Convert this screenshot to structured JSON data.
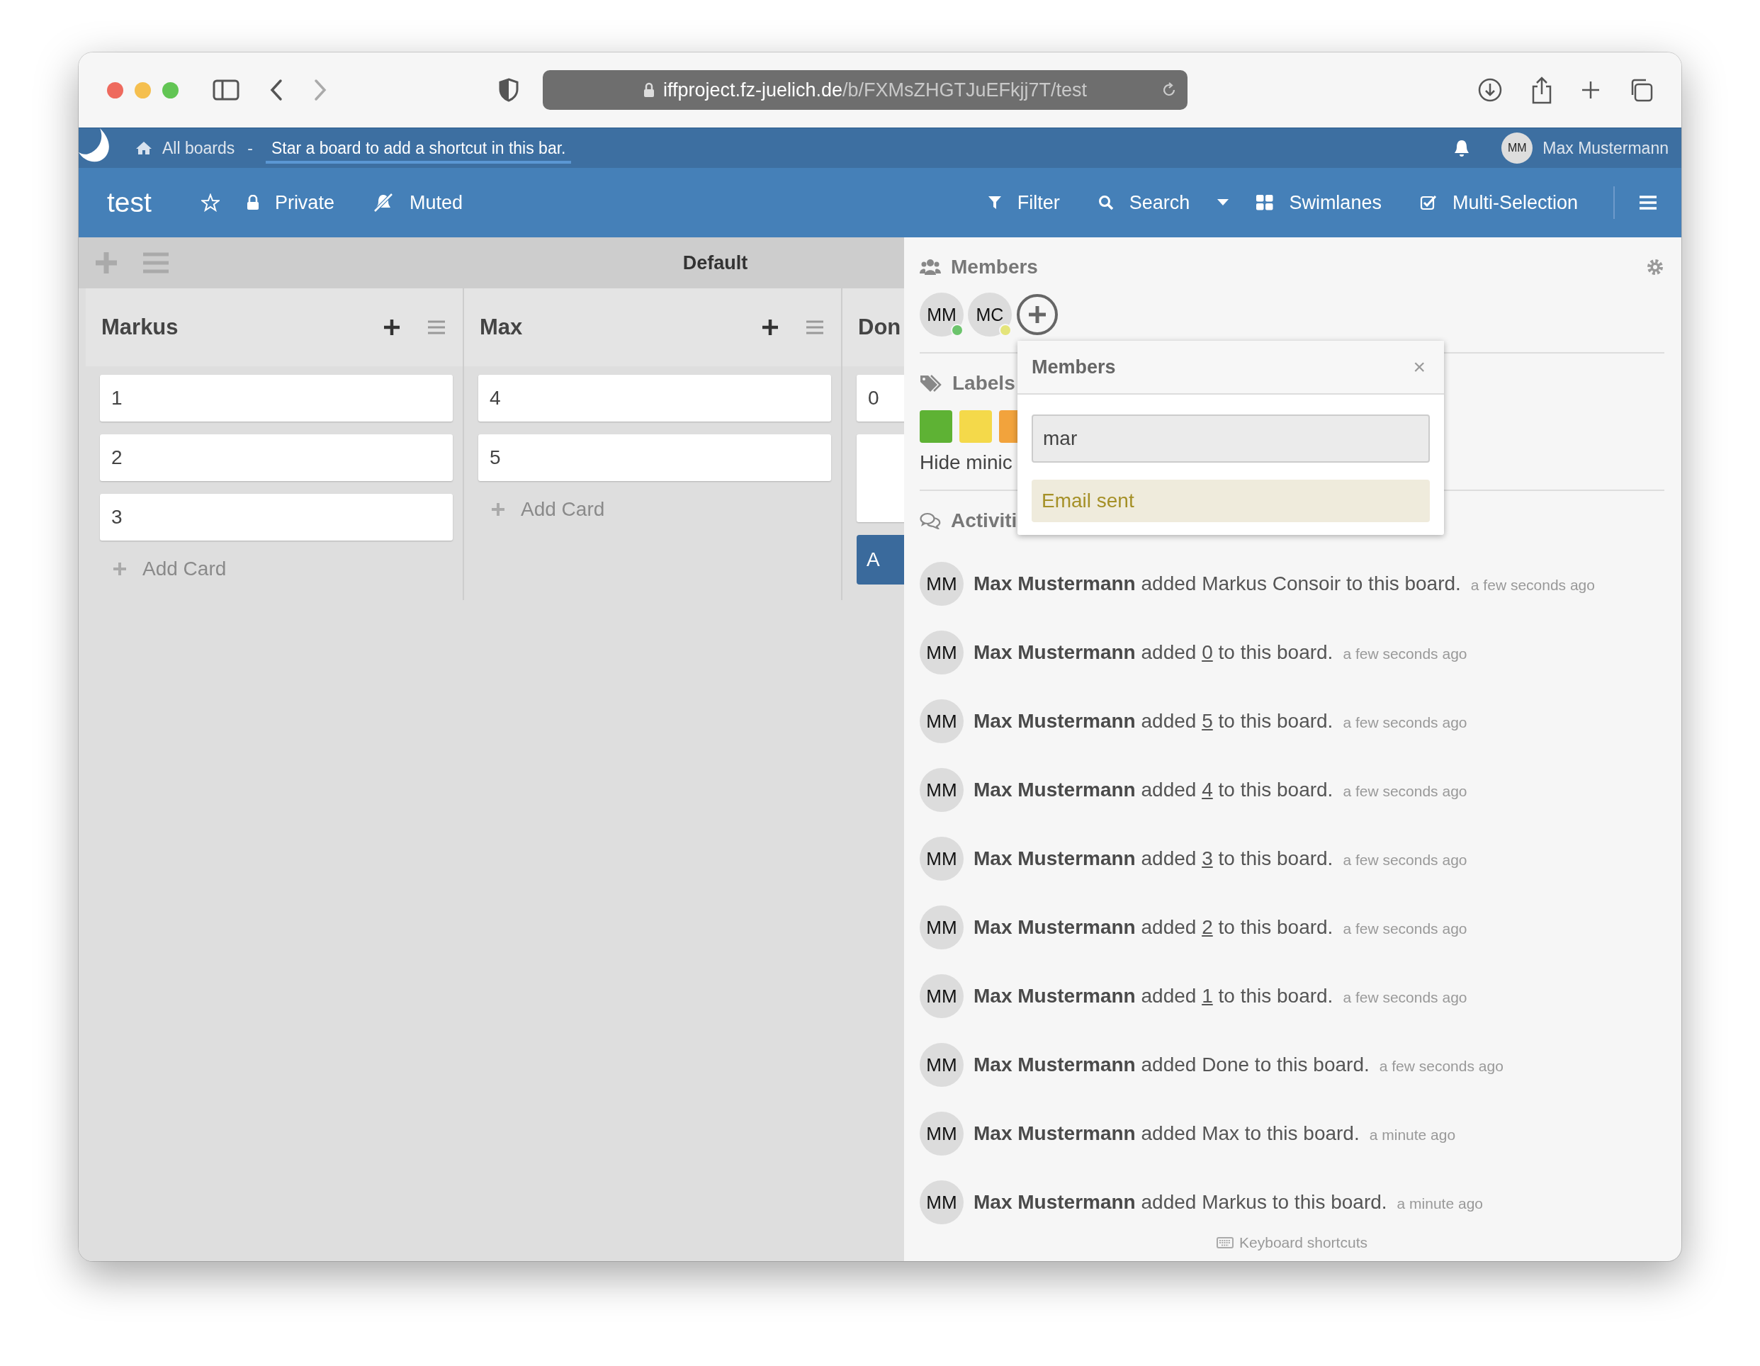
{
  "browser": {
    "url_host": "iffproject.fz-juelich.de",
    "url_path": "/b/FXMsZHGTJuEFkjj7T/test"
  },
  "top_bar": {
    "all_boards": "All boards",
    "separator": "-",
    "shortcut_hint": "Star a board to add a shortcut in this bar.",
    "user_initials": "MM",
    "user_name": "Max Mustermann"
  },
  "board_header": {
    "title": "test",
    "visibility": "Private",
    "watch": "Muted",
    "filter": "Filter",
    "search": "Search",
    "view": "Swimlanes",
    "multi_selection": "Multi-Selection"
  },
  "swimlane": {
    "title": "Default"
  },
  "lists": [
    {
      "title": "Markus",
      "cards": [
        {
          "kind": "text",
          "text": "1"
        },
        {
          "kind": "text",
          "text": "2"
        },
        {
          "kind": "text",
          "text": "3"
        }
      ],
      "add_card": "Add Card"
    },
    {
      "title": "Max",
      "cards": [
        {
          "kind": "text",
          "text": "4"
        },
        {
          "kind": "text",
          "text": "5"
        }
      ],
      "add_card": "Add Card"
    },
    {
      "title": "Don",
      "cards": [
        {
          "kind": "text",
          "text": "0"
        },
        {
          "kind": "blank"
        }
      ],
      "button": "A"
    }
  ],
  "sidebar": {
    "members_title": "Members",
    "members": [
      {
        "initials": "MM",
        "color": "#6cc46c"
      },
      {
        "initials": "MC",
        "color": "#e4e47a"
      }
    ],
    "labels_title": "Labels",
    "labels": [
      {
        "color": "#5eb234"
      },
      {
        "color": "#f4d94a"
      },
      {
        "color": "#f2a33c"
      }
    ],
    "hide_minicard": "Hide minic",
    "activities_title": "Activiti",
    "activities": [
      {
        "initials": "MM",
        "user": "Max Mustermann",
        "verb": "added",
        "object": "Markus Consoir",
        "linked": false,
        "rest": "to this board.",
        "time": "a few seconds ago"
      },
      {
        "initials": "MM",
        "user": "Max Mustermann",
        "verb": "added",
        "object": "0",
        "linked": true,
        "rest": "to this board.",
        "time": "a few seconds ago"
      },
      {
        "initials": "MM",
        "user": "Max Mustermann",
        "verb": "added",
        "object": "5",
        "linked": true,
        "rest": "to this board.",
        "time": "a few seconds ago"
      },
      {
        "initials": "MM",
        "user": "Max Mustermann",
        "verb": "added",
        "object": "4",
        "linked": true,
        "rest": "to this board.",
        "time": "a few seconds ago"
      },
      {
        "initials": "MM",
        "user": "Max Mustermann",
        "verb": "added",
        "object": "3",
        "linked": true,
        "rest": "to this board.",
        "time": "a few seconds ago"
      },
      {
        "initials": "MM",
        "user": "Max Mustermann",
        "verb": "added",
        "object": "2",
        "linked": true,
        "rest": "to this board.",
        "time": "a few seconds ago"
      },
      {
        "initials": "MM",
        "user": "Max Mustermann",
        "verb": "added",
        "object": "1",
        "linked": true,
        "rest": "to this board.",
        "time": "a few seconds ago"
      },
      {
        "initials": "MM",
        "user": "Max Mustermann",
        "verb": "added",
        "object": "Done",
        "linked": false,
        "rest": "to this board.",
        "time": "a few seconds ago"
      },
      {
        "initials": "MM",
        "user": "Max Mustermann",
        "verb": "added",
        "object": "Max",
        "linked": false,
        "rest": "to this board.",
        "time": "a minute ago"
      },
      {
        "initials": "MM",
        "user": "Max Mustermann",
        "verb": "added",
        "object": "Markus",
        "linked": false,
        "rest": "to this board.",
        "time": "a minute ago"
      }
    ],
    "keyboard_shortcuts": "Keyboard shortcuts"
  },
  "members_popup": {
    "title": "Members",
    "close": "×",
    "search_value": "mar",
    "message": "Email sent"
  }
}
